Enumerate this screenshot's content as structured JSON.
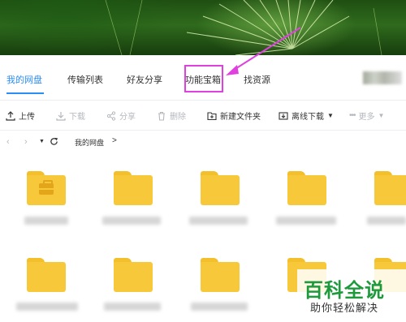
{
  "tabs": [
    {
      "label": "我的网盘"
    },
    {
      "label": "传输列表"
    },
    {
      "label": "好友分享"
    },
    {
      "label": "功能宝箱"
    },
    {
      "label": "找资源"
    }
  ],
  "toolbar": {
    "upload": "上传",
    "download": "下载",
    "share": "分享",
    "delete": "删除",
    "new_folder": "新建文件夹",
    "offline_download": "离线下载",
    "more": "更多"
  },
  "path": {
    "crumb": "我的网盘",
    "separator": ">"
  },
  "watermark": {
    "main": "百科全说",
    "sub": "助你轻松解决"
  },
  "colors": {
    "accent": "#2b8ef7",
    "highlight": "#e040e0",
    "folder": "#f7c93a"
  }
}
